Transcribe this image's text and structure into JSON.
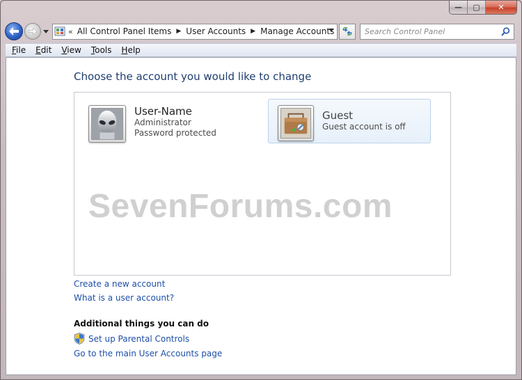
{
  "window": {
    "caption": {
      "min_glyph": "—",
      "max_glyph": "▢",
      "close_glyph": "✕"
    }
  },
  "address": {
    "chevron": "«",
    "breadcrumbs": [
      "All Control Panel Items",
      "User Accounts",
      "Manage Accounts"
    ]
  },
  "search": {
    "placeholder": "Search Control Panel"
  },
  "menu": {
    "items": [
      {
        "u": "F",
        "rest": "ile"
      },
      {
        "u": "E",
        "rest": "dit"
      },
      {
        "u": "V",
        "rest": "iew"
      },
      {
        "u": "T",
        "rest": "ools"
      },
      {
        "u": "H",
        "rest": "elp"
      }
    ]
  },
  "main": {
    "title": "Choose the account you would like to change",
    "accounts": [
      {
        "name": "User-Name",
        "lines": [
          "Administrator",
          "Password protected"
        ]
      },
      {
        "name": "Guest",
        "lines": [
          "Guest account is off"
        ]
      }
    ],
    "links": {
      "create": "Create a new account",
      "what": "What is a user account?"
    },
    "additional": {
      "heading": "Additional things you can do",
      "parental": "Set up Parental Controls",
      "main_page": "Go to the main User Accounts page"
    }
  },
  "watermark": "SevenForums.com",
  "colors": {
    "link": "#1c4fa8",
    "title": "#1e3d6e",
    "guest_highlight": "#e7f0fa"
  },
  "icons": {
    "back": "back-arrow-icon",
    "forward": "forward-arrow-icon",
    "refresh": "refresh-icon",
    "search": "search-icon",
    "control_panel": "control-panel-icon",
    "parental": "shield-icon"
  }
}
